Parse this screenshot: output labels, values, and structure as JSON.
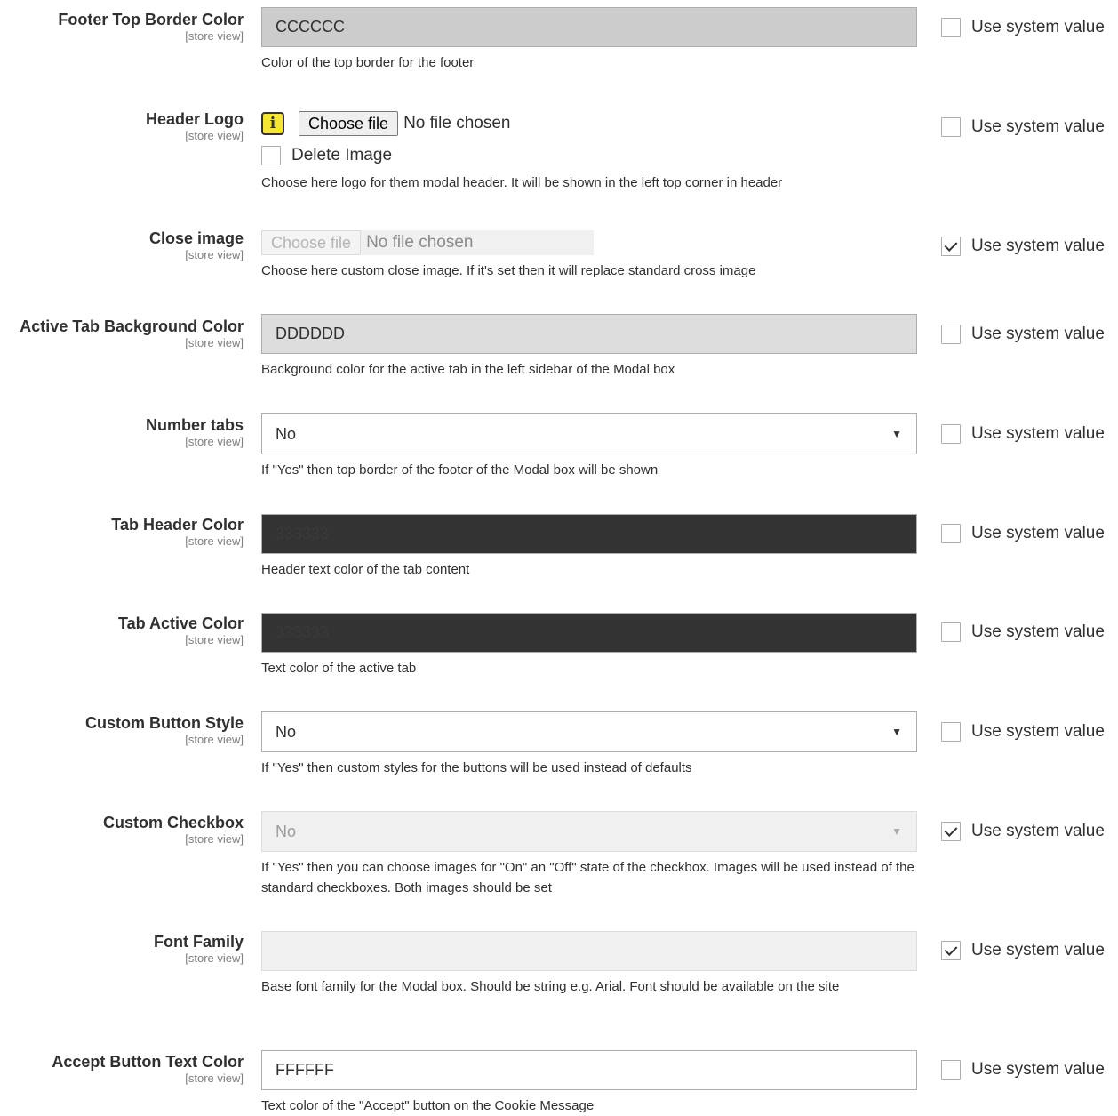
{
  "scope_label": "[store view]",
  "use_system_label": "Use system value",
  "fields": {
    "footer_top_border": {
      "label": "Footer Top Border Color",
      "value": "CCCCCC",
      "bg": "#cccccc",
      "note": "Color of the top border for the footer",
      "use_system": false
    },
    "header_logo": {
      "label": "Header Logo",
      "info_icon": "info-icon",
      "choose_label": "Choose file",
      "file_status": "No file chosen",
      "delete_label": "Delete Image",
      "note": "Choose here logo for them modal header. It will be shown in the left top corner in header",
      "use_system": false
    },
    "close_image": {
      "label": "Close image",
      "choose_label": "Choose file",
      "file_status": "No file chosen",
      "note": "Choose here custom close image. If it's set then it will replace standard cross image",
      "use_system": true
    },
    "active_tab_bg": {
      "label": "Active Tab Background Color",
      "value": "DDDDDD",
      "bg": "#dddddd",
      "note": "Background color for the active tab in the left sidebar of the Modal box",
      "use_system": false
    },
    "number_tabs": {
      "label": "Number tabs",
      "value": "No",
      "note": "If \"Yes\" then top border of the footer of the Modal box will be shown",
      "use_system": false
    },
    "tab_header_color": {
      "label": "Tab Header Color",
      "value": "333333",
      "bg": "#333333",
      "note": "Header text color of the tab content",
      "use_system": false
    },
    "tab_active_color": {
      "label": "Tab Active Color",
      "value": "333333",
      "bg": "#333333",
      "note": "Text color of the active tab",
      "use_system": false
    },
    "custom_button_style": {
      "label": "Custom Button Style",
      "value": "No",
      "note": "If \"Yes\" then custom styles for the buttons will be used instead of defaults",
      "use_system": false
    },
    "custom_checkbox": {
      "label": "Custom Checkbox",
      "value": "No",
      "note": "If \"Yes\" then you can choose images for \"On\" an \"Off\" state of the checkbox. Images will be used instead of the standard checkboxes. Both images should be set",
      "use_system": true
    },
    "font_family": {
      "label": "Font Family",
      "value": "",
      "note": "Base font family for the Modal box. Should be string e.g. Arial. Font should be available on the site",
      "use_system": true
    },
    "accept_button_text_color": {
      "label": "Accept Button Text Color",
      "value": "FFFFFF",
      "bg": "#ffffff",
      "note": "Text color of the \"Accept\" button on the Cookie Message",
      "use_system": false
    }
  }
}
